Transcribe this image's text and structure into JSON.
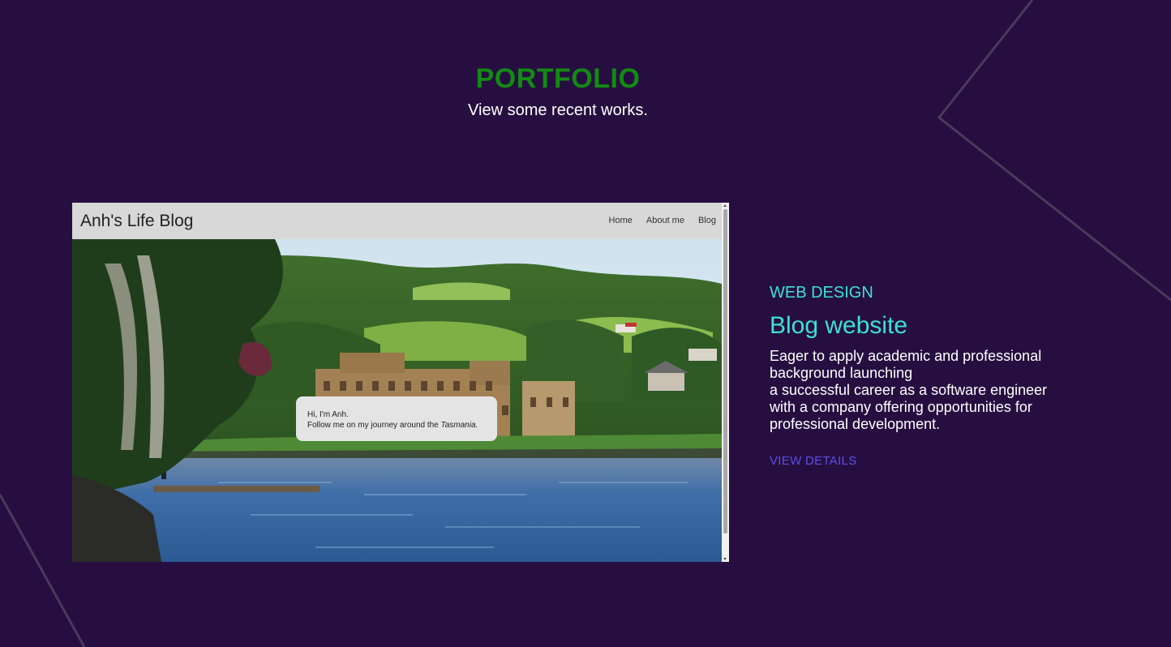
{
  "section": {
    "title": "PORTFOLIO",
    "subtitle": "View some recent works."
  },
  "preview": {
    "brand": "Anh's Life Blog",
    "nav_links": [
      "Home",
      "About me",
      "Blog"
    ],
    "bubble_line1": "Hi, I'm Anh.",
    "bubble_line2_prefix": "Follow me on my journey around the ",
    "bubble_line2_place": "Tasmania."
  },
  "project": {
    "category": "WEB DESIGN",
    "title": "Blog website",
    "description_lines": [
      "Eager to apply academic and professional background launching",
      "a successful career as a software engineer with a company offering opportunities for professional development."
    ],
    "link_label": "VIEW DETAILS"
  },
  "colors": {
    "background": "#260f40",
    "title_green": "#138a13",
    "accent_cyan": "#3ee0d6",
    "link_purple": "#5b4fe6"
  }
}
